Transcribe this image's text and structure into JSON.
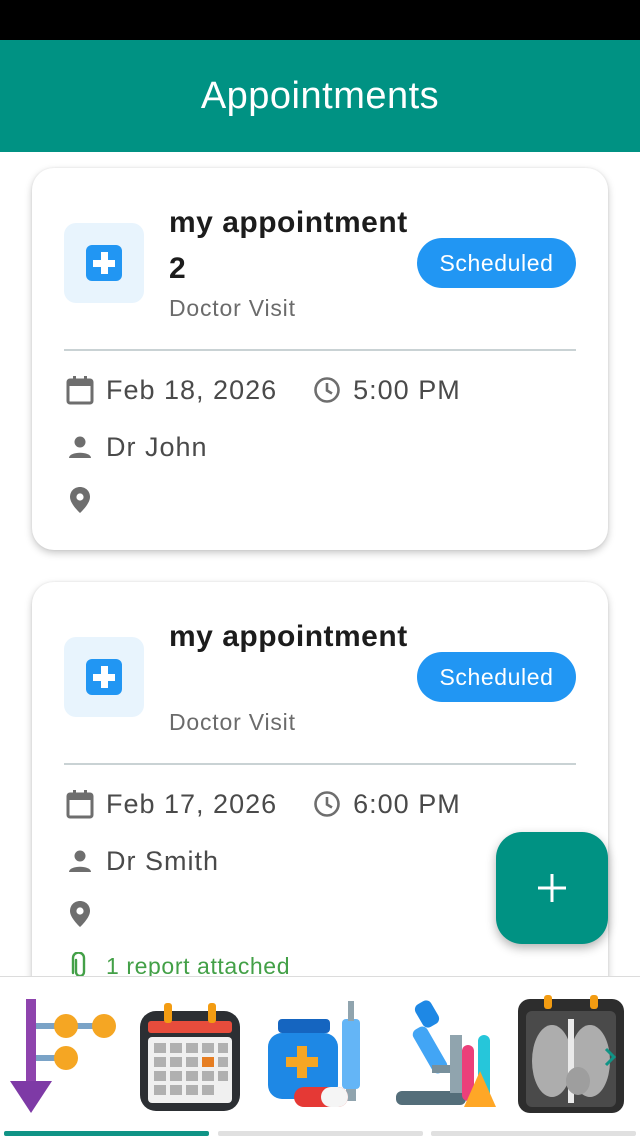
{
  "header": {
    "title": "Appointments"
  },
  "appointments": [
    {
      "title": "my appointment 2",
      "type": "Doctor Visit",
      "status": "Scheduled",
      "date": "Feb 18, 2026",
      "time": "5:00 PM",
      "doctor": "Dr John",
      "location": ""
    },
    {
      "title": "my appointment",
      "type": "Doctor Visit",
      "status": "Scheduled",
      "date": "Feb 17, 2026",
      "time": "6:00 PM",
      "doctor": "Dr Smith",
      "location": "",
      "attachments": "1 report attached"
    }
  ],
  "fab": {
    "icon": "plus-icon"
  },
  "colors": {
    "primary": "#009283",
    "badge": "#2196f3",
    "attachment": "#43a047"
  },
  "bottom_tiles": [
    {
      "icon": "workflow-icon"
    },
    {
      "icon": "calendar-icon"
    },
    {
      "icon": "medicine-icon"
    },
    {
      "icon": "microscope-icon"
    },
    {
      "icon": "xray-icon"
    }
  ]
}
